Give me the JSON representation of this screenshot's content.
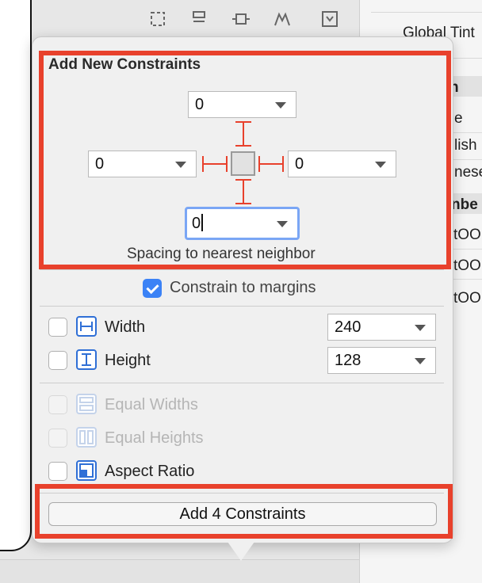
{
  "inspector": {
    "global_tint_label": "Global Tint",
    "partial_rows": [
      "n",
      "e",
      "lish",
      "nese",
      "nbe",
      "tOO",
      "tOO",
      "tOO"
    ]
  },
  "popover": {
    "title": "Add New Constraints",
    "spacing": {
      "top": "0",
      "left": "0",
      "right": "0",
      "bottom": "0",
      "caption": "Spacing to nearest neighbor"
    },
    "constrain_to_margins": {
      "label": "Constrain to margins",
      "checked": true
    },
    "width": {
      "label": "Width",
      "value": "240",
      "checked": false
    },
    "height": {
      "label": "Height",
      "value": "128",
      "checked": false
    },
    "equal_widths": {
      "label": "Equal Widths",
      "enabled": false
    },
    "equal_heights": {
      "label": "Equal Heights",
      "enabled": false
    },
    "aspect_ratio": {
      "label": "Aspect Ratio",
      "checked": false
    },
    "add_button_label": "Add 4 Constraints"
  },
  "colors": {
    "accent": "#3b82f6",
    "strut": "#e8412c",
    "highlight": "#e8412c",
    "focus_ring": "#7aa6f5"
  },
  "icons": {
    "width": "width-constraint-icon",
    "height": "height-constraint-icon",
    "equal_widths": "equal-widths-icon",
    "equal_heights": "equal-heights-icon",
    "aspect_ratio": "aspect-ratio-icon"
  }
}
